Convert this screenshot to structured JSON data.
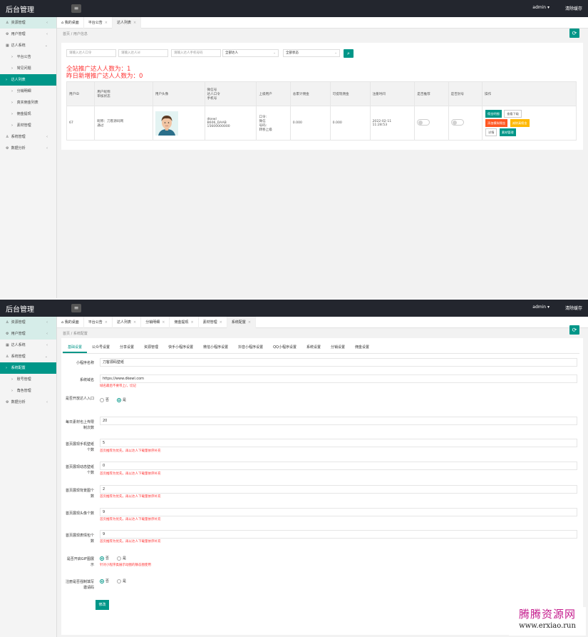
{
  "top": {
    "logo": "后台管理",
    "user": "admin",
    "clear_cache": "清除缓存"
  },
  "screen1": {
    "sidebar": [
      {
        "icon": "user-icon",
        "label": "资源管理",
        "chev": "‹",
        "state": "hl"
      },
      {
        "icon": "gear-icon",
        "label": "用户管理",
        "chev": "‹",
        "state": ""
      },
      {
        "icon": "grid-icon",
        "label": "达人系统",
        "chev": "⌄",
        "state": ""
      },
      {
        "icon": "›",
        "label": "平台公告",
        "chev": "",
        "state": "sub"
      },
      {
        "icon": "›",
        "label": "常见问题",
        "chev": "",
        "state": "sub"
      },
      {
        "icon": "›",
        "label": "达人列表",
        "chev": "",
        "state": "active"
      },
      {
        "icon": "›",
        "label": "分销明细",
        "chev": "",
        "state": "sub"
      },
      {
        "icon": "›",
        "label": "真实佣金列表",
        "chev": "",
        "state": "sub"
      },
      {
        "icon": "›",
        "label": "佣金提现",
        "chev": "",
        "state": "sub"
      },
      {
        "icon": "›",
        "label": "素材管理",
        "chev": "",
        "state": "sub"
      },
      {
        "icon": "user-icon",
        "label": "系统管理",
        "chev": "‹",
        "state": ""
      },
      {
        "icon": "gear-icon",
        "label": "数据分析",
        "chev": "‹",
        "state": ""
      }
    ],
    "tabs": [
      {
        "label": "我的桌面",
        "close": "",
        "active": false
      },
      {
        "label": "平台公告",
        "close": "×",
        "active": false
      },
      {
        "label": "达人列表",
        "close": "×",
        "active": true
      }
    ],
    "breadcrumb": "首页 / 用户信息",
    "filters": {
      "ph_code": "请输入达人口令",
      "ph_id": "请输入达人id",
      "ph_phone": "请输入达人手机号码",
      "sel1": "全部达人",
      "sel2": "全部状态"
    },
    "stat1": "全站推广达人人数为：1",
    "stat2": "昨日新增推广达人人数为：0",
    "table": {
      "headers": [
        "用户ID",
        "用户昵称\n审核状态",
        "用户头像",
        "微信号\n达人口令\n手机号",
        "上级用户",
        "总累计佣金",
        "可提现佣金",
        "注册时间",
        "是否推荐",
        "是否封号",
        "操作"
      ],
      "row": {
        "id": "67",
        "nick": "昵称：刀客源码网\n通过",
        "wx": "dkewl\nB606_DAAB\n15600000000",
        "parent": "口令:\n微信\n号码:\n转移上级",
        "total": "0.000",
        "withdraw": "0.000",
        "time": "2022-02-11\n11:28:53"
      },
      "ops": [
        "佣金明细",
        "查看下级",
        "添加模拟佣金",
        "减除真佣金",
        "详情",
        "素材管理"
      ]
    }
  },
  "screen2": {
    "sidebar": [
      {
        "icon": "user-icon",
        "label": "资源管理",
        "chev": "‹",
        "state": "hl"
      },
      {
        "icon": "gear-icon",
        "label": "用户管理",
        "chev": "‹",
        "state": "hl"
      },
      {
        "icon": "grid-icon",
        "label": "达人系统",
        "chev": "‹",
        "state": ""
      },
      {
        "icon": "user-icon",
        "label": "系统管理",
        "chev": "⌄",
        "state": ""
      },
      {
        "icon": "›",
        "label": "系统配置",
        "chev": "",
        "state": "active"
      },
      {
        "icon": "›",
        "label": "账号管理",
        "chev": "",
        "state": "sub"
      },
      {
        "icon": "›",
        "label": "角色管理",
        "chev": "",
        "state": "sub"
      },
      {
        "icon": "gear-icon",
        "label": "数据分析",
        "chev": "‹",
        "state": ""
      }
    ],
    "tabs": [
      {
        "label": "我的桌面",
        "close": "",
        "active": false
      },
      {
        "label": "平台公告",
        "close": "×",
        "active": false
      },
      {
        "label": "达人列表",
        "close": "×",
        "active": false
      },
      {
        "label": "分销明细",
        "close": "×",
        "active": false
      },
      {
        "label": "佣金提现",
        "close": "×",
        "active": false
      },
      {
        "label": "素材管理",
        "close": "×",
        "active": false
      },
      {
        "label": "系统配置",
        "close": "×",
        "active": true
      }
    ],
    "breadcrumb": "首页 / 系统配置",
    "subtabs": [
      "基础设置",
      "公众号设置",
      "分享设置",
      "资源管理",
      "快手小程序设置",
      "微信小程序设置",
      "抖音小程序设置",
      "QQ小程序设置",
      "系统设置",
      "分销设置",
      "佣金设置"
    ],
    "form": {
      "l1": "小程序名称",
      "v1": "刀客源码壁纸",
      "l2": "系统域名",
      "v2": "https://www.dkewl.com",
      "h2": "域名最后不要带上/，切记",
      "l3": "是否开放达人入口",
      "r3a": "否",
      "r3b": "是",
      "l4": "每日素材也上传限制次数",
      "v4": "20",
      "l5": "首页展现手机壁纸个数",
      "v5": "5",
      "h5": "首页推荐为优先，再以达人下载量依序补充",
      "l6": "首页展现动态壁纸个数",
      "v6": "0",
      "h6": "首页推荐为优先，再以达人下载量依序补充",
      "l7": "首页展现背景图个数",
      "v7": "2",
      "h7": "首页推荐为优先，再以达人下载量依序补充",
      "l8": "首页展现头像个数",
      "v8": "9",
      "h8": "首页推荐为优先，再以达人下载量依序补充",
      "l9": "首页展现表情包个数",
      "v9": "9",
      "h9": "首页推荐为优先，再以达人下载量依序补充",
      "l10": "是否开启GIF图展示",
      "r10a": "否",
      "r10b": "是",
      "h10": "针对小程序类展示动图的静态图使用",
      "l11": "注册是否强制填写邀请码",
      "r11a": "否",
      "r11b": "是",
      "save": "修改"
    }
  },
  "watermark": {
    "line1": "腾腾资源网",
    "line2": "www.erxiao.run"
  }
}
